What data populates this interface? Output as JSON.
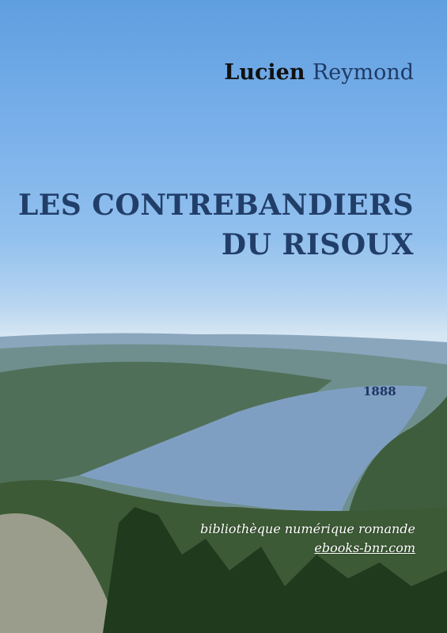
{
  "author": {
    "first_name": "Lucien",
    "last_name": "Reymond"
  },
  "title": {
    "line1": "LES CONTREBANDIERS",
    "line2": "DU RISOUX"
  },
  "year": "1888",
  "publisher": {
    "name": "bibliothèque numérique romande",
    "url": "ebooks-bnr.com"
  }
}
